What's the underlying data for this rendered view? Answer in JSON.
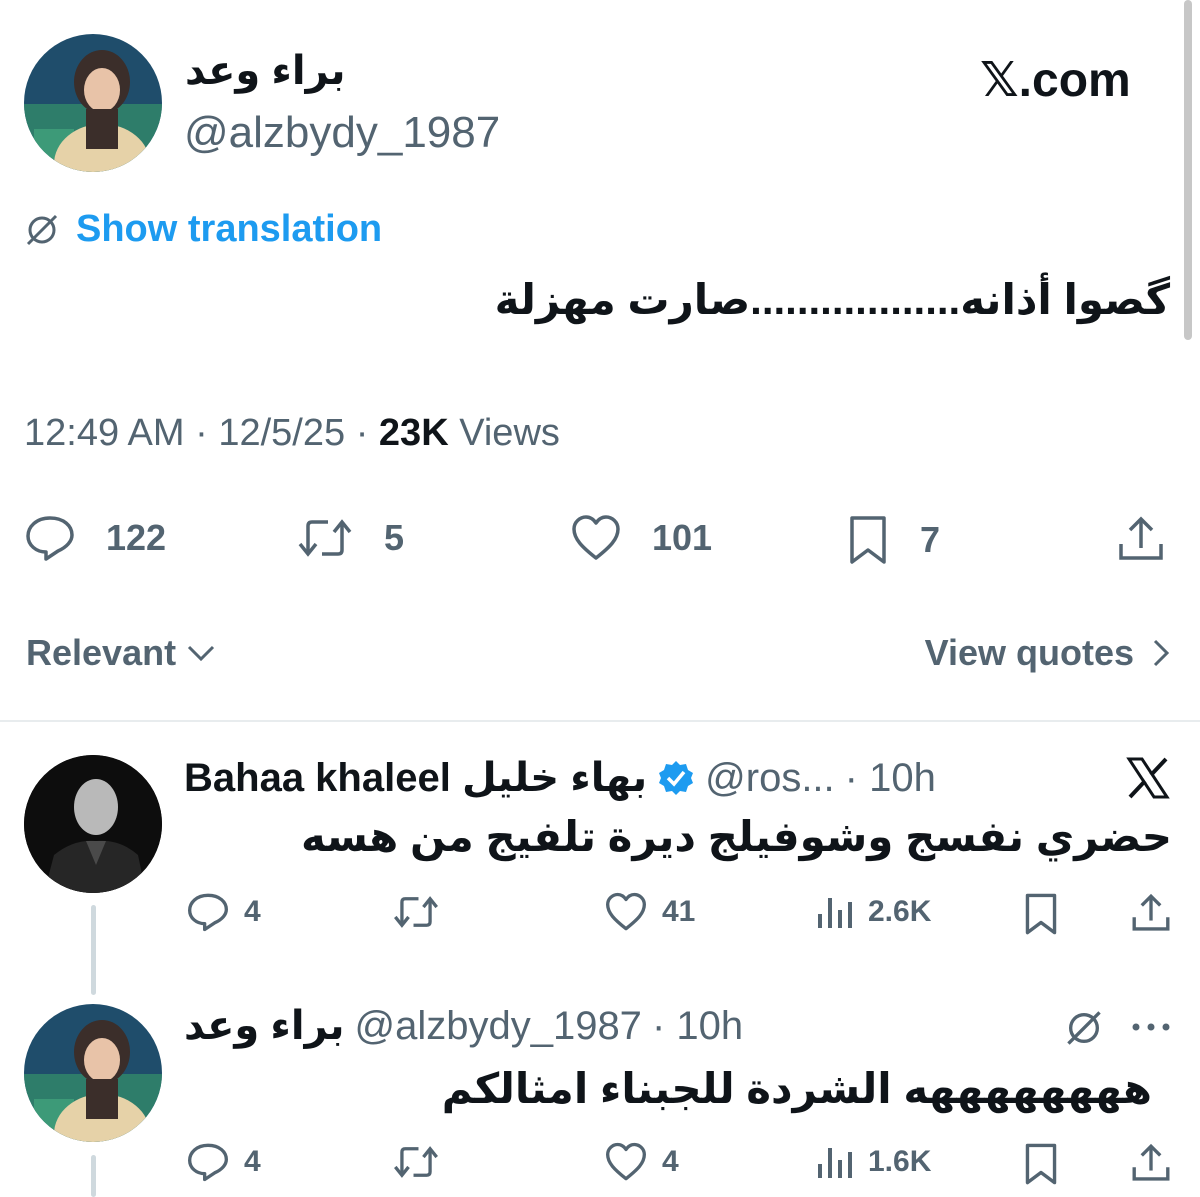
{
  "main_tweet": {
    "author_name": "براء وعد",
    "handle": "@alzbydy_1987",
    "brand": "𝕏.com",
    "translate_label": "Show translation",
    "text": "گصوا أذانه..................صارت مهزلة",
    "time": "12:49 AM",
    "date": "12/5/25",
    "views_count": "23K",
    "views_label": "Views",
    "separator": "·",
    "replies": "122",
    "reposts": "5",
    "likes": "101",
    "bookmarks": "7"
  },
  "sort": {
    "label": "Relevant",
    "view_quotes": "View quotes"
  },
  "replies": [
    {
      "display_name": "Bahaa khaleel بهاء خليل",
      "verified": true,
      "handle": "@ros...",
      "time": "· 10h",
      "text": "حضري نفسج وشوفيلج ديرة تلفيج من هسه",
      "replies": "4",
      "reposts": "",
      "likes": "41",
      "views": "2.6K"
    },
    {
      "display_name": "براء وعد",
      "handle": "@alzbydy_1987",
      "time": "· 10h",
      "text": "ههههههههه الشردة للجبناء امثالكم",
      "replies": "4",
      "reposts": "",
      "likes": "4",
      "views": "1.6K"
    }
  ],
  "colors": {
    "accent": "#1d9bf0",
    "text_primary": "#0f1419",
    "text_secondary": "#536471",
    "divider": "#e8ecee"
  }
}
